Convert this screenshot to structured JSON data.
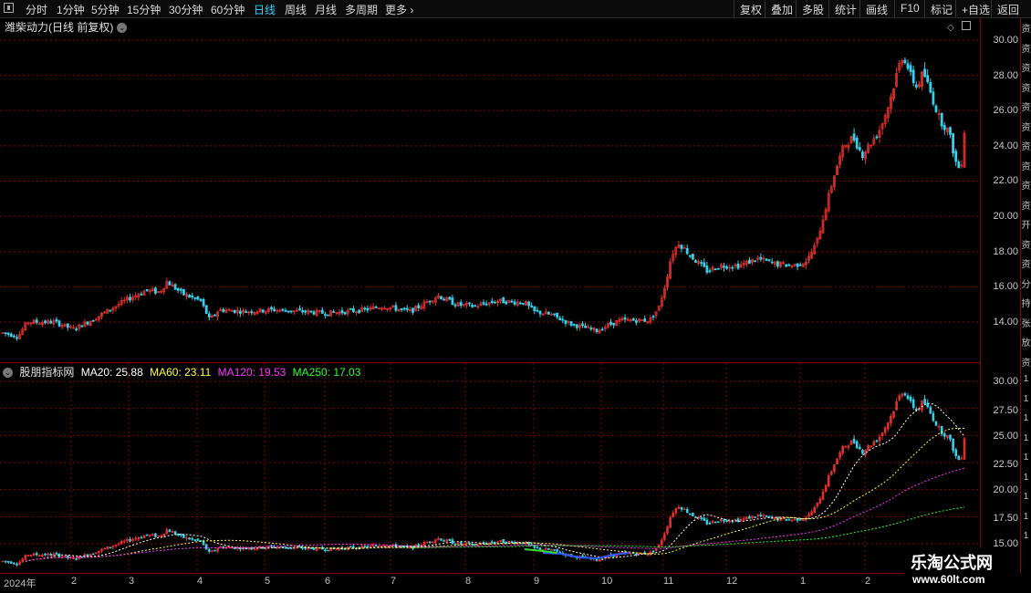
{
  "toolbar": {
    "periods": [
      "分时",
      "1分钟",
      "5分钟",
      "15分钟",
      "30分钟",
      "60分钟",
      "日线",
      "周线",
      "月线",
      "多周期",
      "更多"
    ],
    "active_period": "日线",
    "right_buttons": [
      "复权",
      "叠加",
      "多股",
      "统计",
      "画线",
      "F10",
      "标记",
      "+自选",
      "返回"
    ]
  },
  "main_panel": {
    "title": "潍柴动力(日线 前复权)",
    "y_labels": [
      "30.00",
      "28.00",
      "26.00",
      "24.00",
      "22.00",
      "20.00",
      "18.00",
      "16.00",
      "14.00"
    ]
  },
  "indicator_panel": {
    "name": "股朋指标网",
    "ma20": "MA20: 25.88",
    "ma60": "MA60: 23.11",
    "ma120": "MA120: 19.53",
    "ma250": "MA250: 17.03",
    "y_labels": [
      "30.00",
      "27.50",
      "25.00",
      "22.50",
      "20.00",
      "17.50",
      "15.00"
    ]
  },
  "x_axis": {
    "labels": [
      "2024年",
      "2",
      "3",
      "4",
      "5",
      "6",
      "7",
      "8",
      "9",
      "10",
      "11",
      "12",
      "1",
      "2"
    ]
  },
  "side_strip": {
    "chars": [
      "资",
      "资",
      "资",
      "资",
      "资",
      "资",
      "资",
      "资",
      "资",
      "资",
      "开",
      "资",
      "资",
      "分",
      "持",
      "张",
      "放",
      "资",
      "1",
      "1",
      "1",
      "1",
      "1",
      "1",
      "1",
      "1",
      "1"
    ]
  },
  "watermark": {
    "line1": "乐淘公式网",
    "line2": "www.60lt.com"
  },
  "colors": {
    "up": "#e0302c",
    "down": "#36d0e8",
    "ma20": "#ffffff",
    "ma60": "#ffff33",
    "ma120": "#ff33ff",
    "ma250": "#33ff33",
    "active": "#33d1ff",
    "grid": "#8b0000"
  },
  "chart_data": {
    "type": "candlestick",
    "title": "潍柴动力(日线 前复权)",
    "ylim_main": [
      13.0,
      30.5
    ],
    "ylim_indicator": [
      14.8,
      30.8
    ],
    "months": [
      "2024年",
      "2",
      "3",
      "4",
      "5",
      "6",
      "7",
      "8",
      "9",
      "10",
      "11",
      "12",
      "1",
      "2"
    ],
    "monthly_close_approx": [
      13.6,
      14.3,
      15.9,
      15.2,
      14.7,
      14.7,
      14.8,
      15.2,
      14.4,
      14.1,
      17.8,
      17.3,
      20.0,
      28.0
    ],
    "last_close_approx": 25.3,
    "ma_values": {
      "MA20": 25.88,
      "MA60": 23.11,
      "MA120": 19.53,
      "MA250": 17.03
    }
  }
}
